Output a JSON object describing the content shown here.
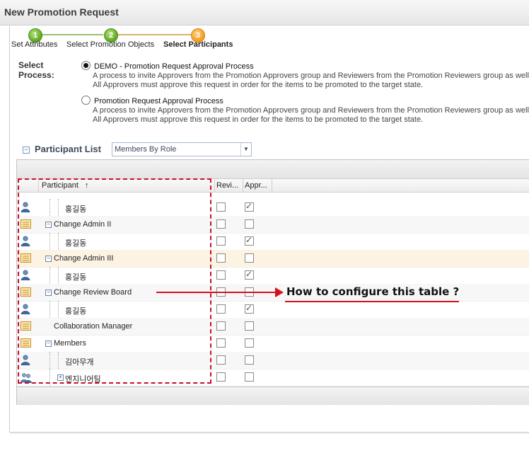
{
  "window": {
    "title": "New Promotion Request"
  },
  "wizard": {
    "steps": [
      {
        "number": "1",
        "label": "Set Attributes"
      },
      {
        "number": "2",
        "label": "Select Promotion Objects"
      },
      {
        "number": "3",
        "label": "Select Participants"
      }
    ]
  },
  "select_process": {
    "label": "Select\nProcess:",
    "options": [
      {
        "name": "DEMO - Promotion Request Approval Process",
        "desc1": "A process to invite Approvers from the Promotion Approvers group and Reviewers from the Promotion Reviewers group as well",
        "desc2": "All Approvers must approve this request in order for the items to be promoted to the target state.",
        "selected": true
      },
      {
        "name": "Promotion Request Approval Process",
        "desc1": "A process to invite Approvers from the Promotion Approvers group and Reviewers from the Promotion Reviewers group as well",
        "desc2": "All Approvers must approve this request in order for the items to be promoted to the target state.",
        "selected": false
      }
    ]
  },
  "participant_list": {
    "toggle": "−",
    "title": "Participant List",
    "view_select": "Members By Role"
  },
  "table": {
    "columns": {
      "participant": "Participant",
      "sort": "↑",
      "reviewer": "Revi...",
      "approver": "Appr..."
    },
    "rows": [
      {
        "kind": "user",
        "label": "홍길동",
        "expander": "",
        "reviewer": false,
        "approver": true
      },
      {
        "kind": "role",
        "label": "Change Admin II",
        "expander": "−",
        "reviewer": false,
        "approver": false
      },
      {
        "kind": "user",
        "label": "홍길동",
        "expander": "",
        "reviewer": false,
        "approver": true
      },
      {
        "kind": "role",
        "label": "Change Admin III",
        "expander": "−",
        "reviewer": false,
        "approver": false
      },
      {
        "kind": "user",
        "label": "홍길동",
        "expander": "",
        "reviewer": false,
        "approver": true
      },
      {
        "kind": "role",
        "label": "Change Review Board",
        "expander": "−",
        "reviewer": false,
        "approver": false
      },
      {
        "kind": "user",
        "label": "홍길동",
        "expander": "",
        "reviewer": false,
        "approver": true
      },
      {
        "kind": "role",
        "label": "Collaboration Manager",
        "expander": "",
        "reviewer": false,
        "approver": false
      },
      {
        "kind": "role",
        "label": "Members",
        "expander": "−",
        "reviewer": false,
        "approver": false
      },
      {
        "kind": "user",
        "label": "김아무개",
        "expander": "",
        "reviewer": false,
        "approver": false
      },
      {
        "kind": "group",
        "label": "엔지니어팀",
        "expander": "+",
        "reviewer": false,
        "approver": false
      }
    ]
  },
  "annotation": {
    "text": "How to  configure this table ?"
  },
  "colors": {
    "accent_red": "#d6101e",
    "step_done": "#5aa520",
    "step_active": "#f39a1c"
  }
}
